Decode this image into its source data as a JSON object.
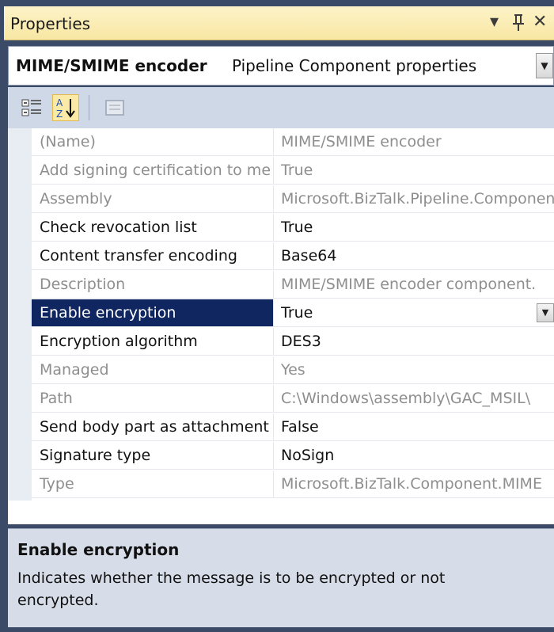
{
  "window": {
    "title": "Properties",
    "title_icons": [
      "dropdown-arrow-icon",
      "pin-icon",
      "close-icon"
    ]
  },
  "selector": {
    "object_name": "MIME/SMIME encoder",
    "object_type": "Pipeline Component properties"
  },
  "toolbar": {
    "buttons": [
      "categorized-icon",
      "alphabetical-sort-icon",
      "property-pages-icon"
    ],
    "active": "alphabetical-sort-icon"
  },
  "properties": [
    {
      "name": "(Name)",
      "value": "MIME/SMIME encoder",
      "readonly": true
    },
    {
      "name": "Add signing certification to message",
      "value": "True",
      "readonly": true
    },
    {
      "name": "Assembly",
      "value": "Microsoft.BizTalk.Pipeline.Components",
      "readonly": true
    },
    {
      "name": "Check revocation list",
      "value": "True",
      "readonly": false
    },
    {
      "name": "Content transfer encoding",
      "value": "Base64",
      "readonly": false
    },
    {
      "name": "Description",
      "value": "MIME/SMIME encoder component.",
      "readonly": true
    },
    {
      "name": "Enable encryption",
      "value": "True",
      "readonly": false,
      "selected": true
    },
    {
      "name": "Encryption algorithm",
      "value": "DES3",
      "readonly": false
    },
    {
      "name": "Managed",
      "value": "Yes",
      "readonly": true
    },
    {
      "name": "Path",
      "value": "C:\\Windows\\assembly\\GAC_MSIL\\",
      "readonly": true
    },
    {
      "name": "Send body part as attachment",
      "value": "False",
      "readonly": false
    },
    {
      "name": "Signature type",
      "value": "NoSign",
      "readonly": false
    },
    {
      "name": "Type",
      "value": "Microsoft.BizTalk.Component.MIME",
      "readonly": true
    }
  ],
  "description": {
    "title": "Enable encryption",
    "text": "Indicates whether the message is to be encrypted or not encrypted."
  },
  "colors": {
    "title_bar": "#f8e7a3",
    "selection": "#0f2660",
    "readonly_text": "#8e8e8e",
    "frame": "#3b4a66"
  }
}
